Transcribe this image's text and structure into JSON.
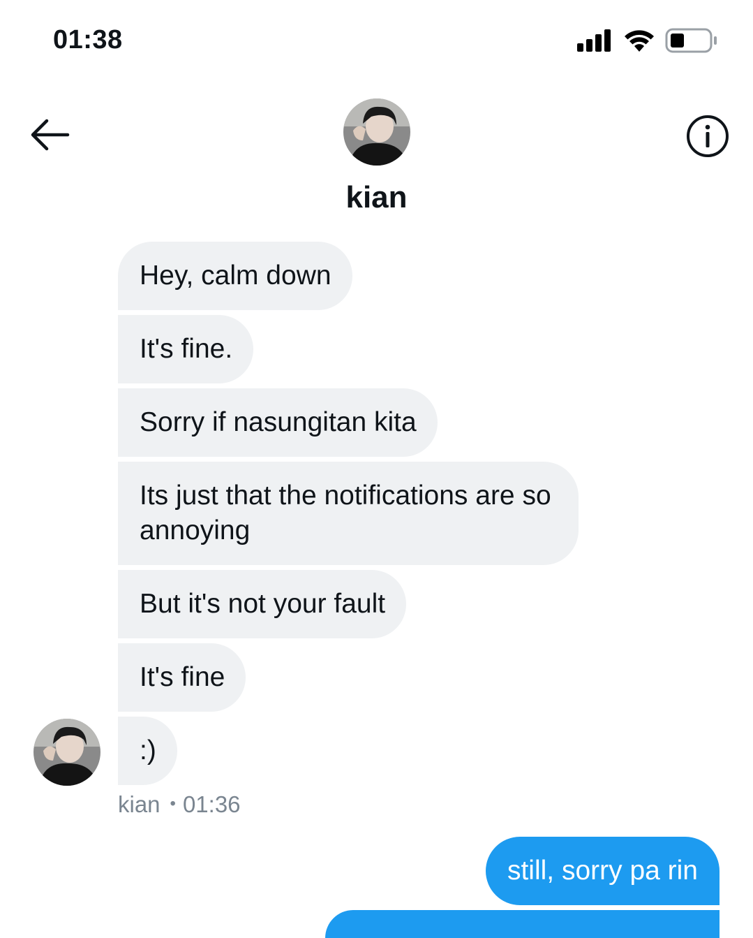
{
  "status_bar": {
    "time": "01:38",
    "icons": [
      "signal-icon",
      "wifi-icon",
      "battery-icon"
    ]
  },
  "header": {
    "back_icon": "arrow-left-icon",
    "info_icon": "info-circle-icon",
    "contact_name": "kian"
  },
  "messages": {
    "incoming": [
      {
        "text": "Hey, calm down"
      },
      {
        "text": "It's fine."
      },
      {
        "text": "Sorry if nasungitan kita"
      },
      {
        "text": "Its just that the notifications are so annoying"
      },
      {
        "text": "But it's not your fault"
      },
      {
        "text": "It's fine"
      },
      {
        "text": ":)"
      }
    ],
    "meta": {
      "sender": "kian",
      "time": "01:36"
    },
    "outgoing": [
      {
        "text": "still, sorry pa rin"
      }
    ]
  },
  "colors": {
    "incoming_bubble": "#eff1f3",
    "outgoing_bubble": "#1d9bf0",
    "meta_text": "#7a8590"
  }
}
